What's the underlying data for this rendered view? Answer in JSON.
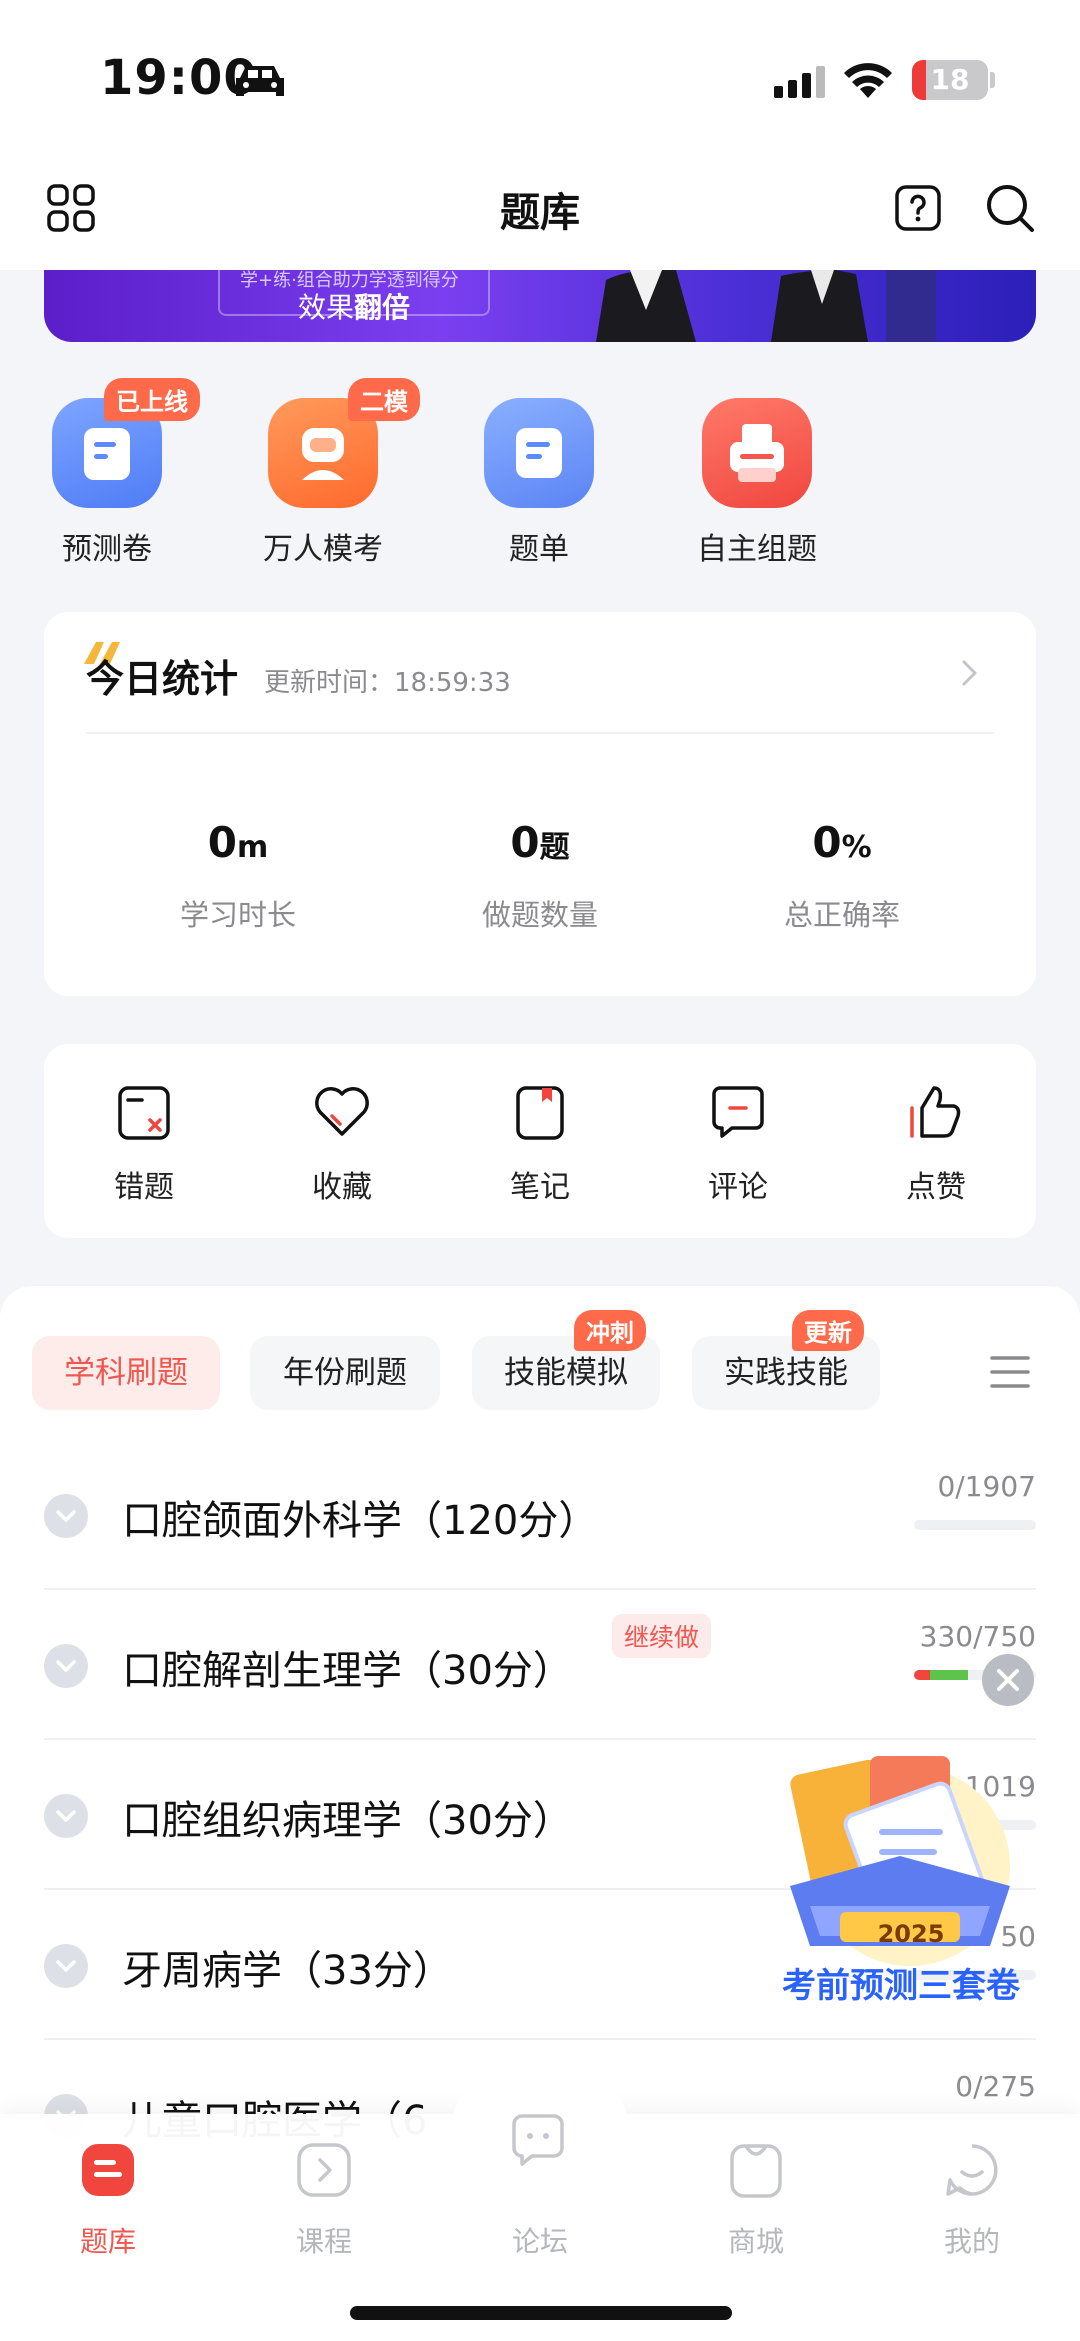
{
  "status_bar": {
    "time": "19:00",
    "battery": "18",
    "battery_level": 0.18
  },
  "header": {
    "title": "题库"
  },
  "banner": {
    "subtitle": "学+练·组合助力学透到得分",
    "main_prefix": "效果",
    "main_emph": "翻倍"
  },
  "entries": [
    {
      "label": "预测卷",
      "badge": "已上线",
      "color": "#5b8cff",
      "icon": "paper-icon"
    },
    {
      "label": "万人模考",
      "badge": "二模",
      "color": "#ff7a3d",
      "icon": "person-icon"
    },
    {
      "label": "题单",
      "badge": "",
      "color": "#5b8cff",
      "icon": "list-icon"
    },
    {
      "label": "自主组题",
      "badge": "",
      "color": "#f3564e",
      "icon": "printer-icon"
    }
  ],
  "today_stats": {
    "title": "今日统计",
    "updated_label": "更新时间：18:59:33",
    "items": [
      {
        "value": "0",
        "unit": "m",
        "label": "学习时长"
      },
      {
        "value": "0",
        "unit": "题",
        "label": "做题数量"
      },
      {
        "value": "0",
        "unit": "%",
        "label": "总正确率"
      }
    ]
  },
  "tools": [
    {
      "label": "错题",
      "icon": "wrong-question-icon"
    },
    {
      "label": "收藏",
      "icon": "heart-icon"
    },
    {
      "label": "笔记",
      "icon": "note-icon"
    },
    {
      "label": "评论",
      "icon": "comment-icon"
    },
    {
      "label": "点赞",
      "icon": "thumbs-up-icon"
    }
  ],
  "tabs": [
    {
      "label": "学科刷题",
      "badge": "",
      "active": true
    },
    {
      "label": "年份刷题",
      "badge": "",
      "active": false
    },
    {
      "label": "技能模拟",
      "badge": "冲刺",
      "active": false
    },
    {
      "label": "实践技能",
      "badge": "更新",
      "active": false
    }
  ],
  "subjects": [
    {
      "title": "口腔颌面外科学（120分）",
      "progress_text": "0/1907",
      "done": 0,
      "total": 1907,
      "continue": ""
    },
    {
      "title": "口腔解剖生理学（30分）",
      "progress_text": "330/750",
      "done": 330,
      "total": 750,
      "continue": "继续做"
    },
    {
      "title": "口腔组织病理学（30分）",
      "progress_text": "1019",
      "done": 0,
      "total": 1019,
      "continue": ""
    },
    {
      "title": "牙周病学（33分）",
      "progress_text": "50",
      "done": 0,
      "total": 50,
      "continue": ""
    },
    {
      "title": "儿童口腔医学（6",
      "progress_text": "0/275",
      "done": 0,
      "total": 275,
      "continue": ""
    }
  ],
  "promo": {
    "year": "2025",
    "text": "考前预测三套卷"
  },
  "bottom_nav": [
    {
      "label": "题库",
      "active": true,
      "icon": "question-bank-icon"
    },
    {
      "label": "课程",
      "active": false,
      "icon": "course-icon"
    },
    {
      "label": "论坛",
      "active": false,
      "icon": "forum-icon"
    },
    {
      "label": "商城",
      "active": false,
      "icon": "store-icon"
    },
    {
      "label": "我的",
      "active": false,
      "icon": "profile-icon"
    }
  ],
  "colors": {
    "accent": "#f0574f",
    "blue": "#2962ff"
  }
}
